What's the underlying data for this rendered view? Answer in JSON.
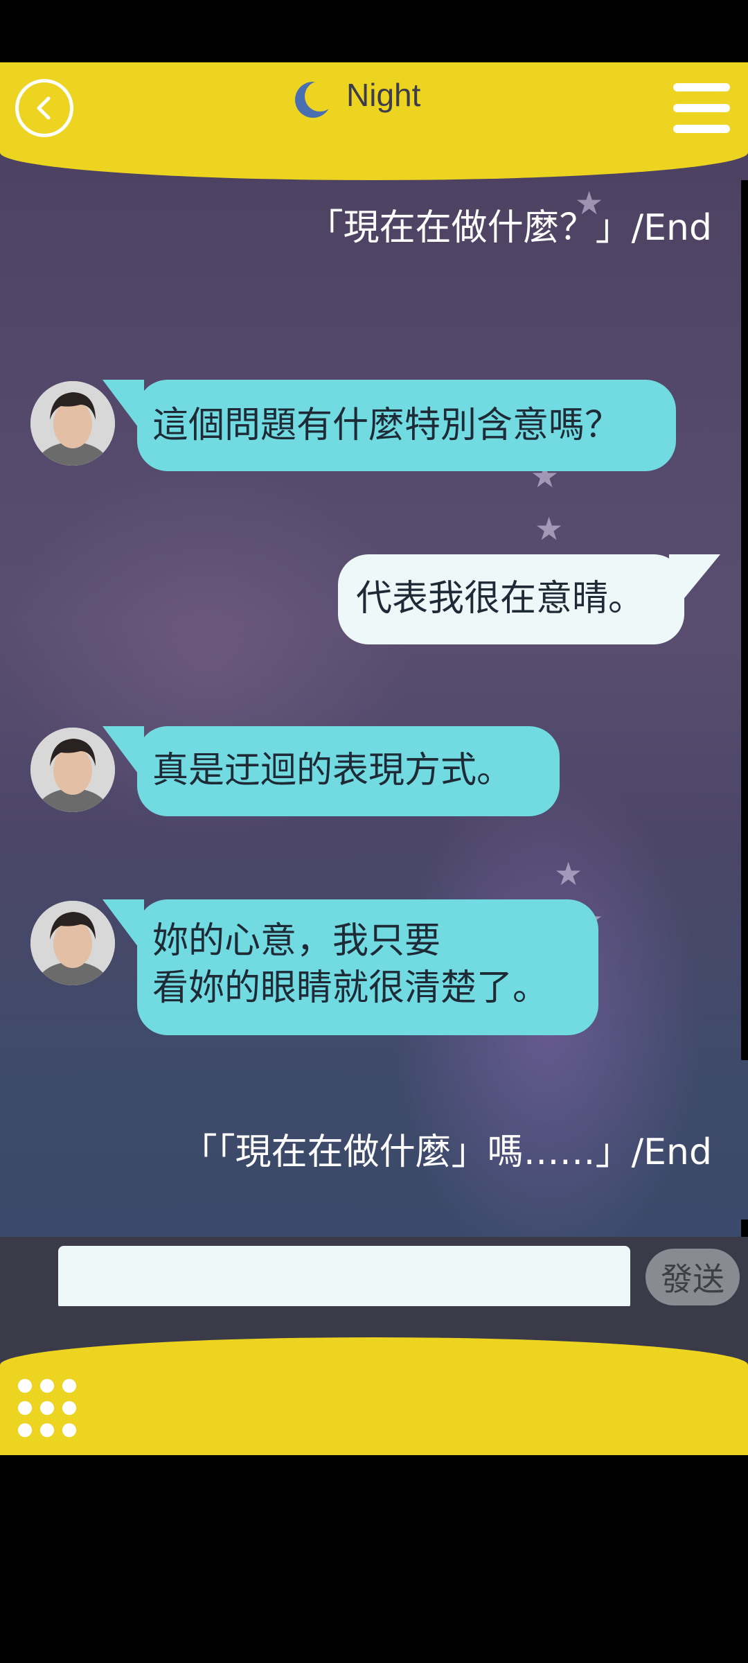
{
  "header": {
    "title": "Night",
    "back_icon": "chevron-left-icon",
    "moon_icon": "crescent-moon-icon",
    "menu_icon": "hamburger-menu-icon"
  },
  "messages": [
    {
      "type": "user_text",
      "text": "「現在在做什麼？」/End"
    },
    {
      "type": "bot",
      "lines": [
        "這個問題有什麼特別含意嗎？"
      ]
    },
    {
      "type": "user",
      "lines": [
        "代表我很在意晴。"
      ]
    },
    {
      "type": "bot",
      "lines": [
        "真是迂迴的表現方式。"
      ]
    },
    {
      "type": "bot",
      "lines": [
        "妳的心意，我只要",
        "看妳的眼睛就很清楚了。"
      ]
    },
    {
      "type": "user_text",
      "text": "「「現在在做什麼」嗎……」/End"
    }
  ],
  "input": {
    "value": "",
    "placeholder": ""
  },
  "send_button": {
    "label": "發送"
  },
  "footer": {
    "grid_icon": "grid-menu-icon"
  },
  "colors": {
    "header_yellow": "#ecd420",
    "bot_bubble": "#72dbe2",
    "user_bubble": "#eef8f9",
    "input_bar": "#3a3a48"
  }
}
